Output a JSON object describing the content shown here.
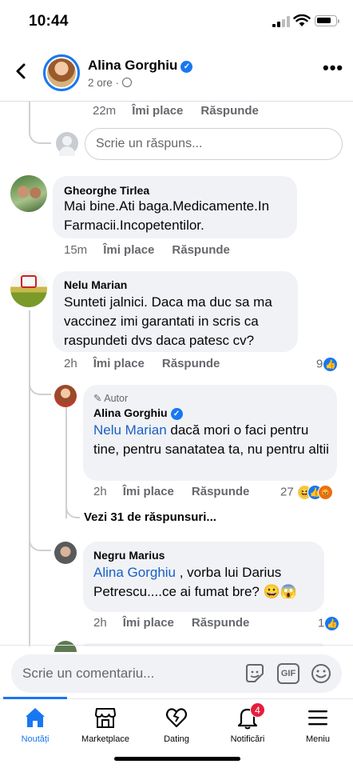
{
  "status_bar": {
    "time": "10:44"
  },
  "header": {
    "name": "Alina Gorghiu",
    "meta": "2 ore ·"
  },
  "top_reply": {
    "time": "22m",
    "like_label": "Îmi place",
    "reply_label": "Răspunde",
    "input_placeholder": "Scrie un răspuns..."
  },
  "comments": [
    {
      "author": "Gheorghe Tirlea",
      "text": "Mai bine.Ati baga.Medicamente.In Farmacii.Incopetentilor.",
      "time": "15m",
      "like_label": "Îmi place",
      "reply_label": "Răspunde"
    },
    {
      "author": "Nelu Marian",
      "text": "Sunteti jalnici. Daca ma duc sa ma vaccinez imi garantati in scris ca raspundeti dvs daca patesc cv?",
      "time": "2h",
      "like_label": "Îmi place",
      "reply_label": "Răspunde",
      "reactions": "9"
    }
  ],
  "replies": [
    {
      "badge": "Autor",
      "author": "Alina Gorghiu",
      "mention": "Nelu Marian",
      "text": " dacă mori o faci pentru tine, pentru sanatatea ta, nu pentru altii",
      "time": "2h",
      "like_label": "Îmi place",
      "reply_label": "Răspunde",
      "reactions": "27"
    },
    {
      "author": "Negru Marius",
      "mention": "Alina Gorghiu",
      "text": " , vorba lui Darius Petrescu....ce ai fumat bre? 😀😱",
      "time": "2h",
      "like_label": "Îmi place",
      "reply_label": "Răspunde",
      "reactions": "1"
    }
  ],
  "see_more": "Vezi 31 de răspunsuri...",
  "composer": {
    "placeholder": "Scrie un comentariu...",
    "gif_label": "GIF"
  },
  "nav": {
    "items": [
      {
        "label": "Noutăți",
        "icon": "home-icon"
      },
      {
        "label": "Marketplace",
        "icon": "marketplace-icon"
      },
      {
        "label": "Dating",
        "icon": "dating-icon"
      },
      {
        "label": "Notificări",
        "icon": "bell-icon"
      },
      {
        "label": "Meniu",
        "icon": "menu-icon"
      }
    ],
    "notif_badge": "4"
  },
  "colors": {
    "accent": "#1877f2",
    "bubble": "#f0f2f5",
    "badge": "#e41e3f",
    "mention": "#1a5fc7"
  }
}
